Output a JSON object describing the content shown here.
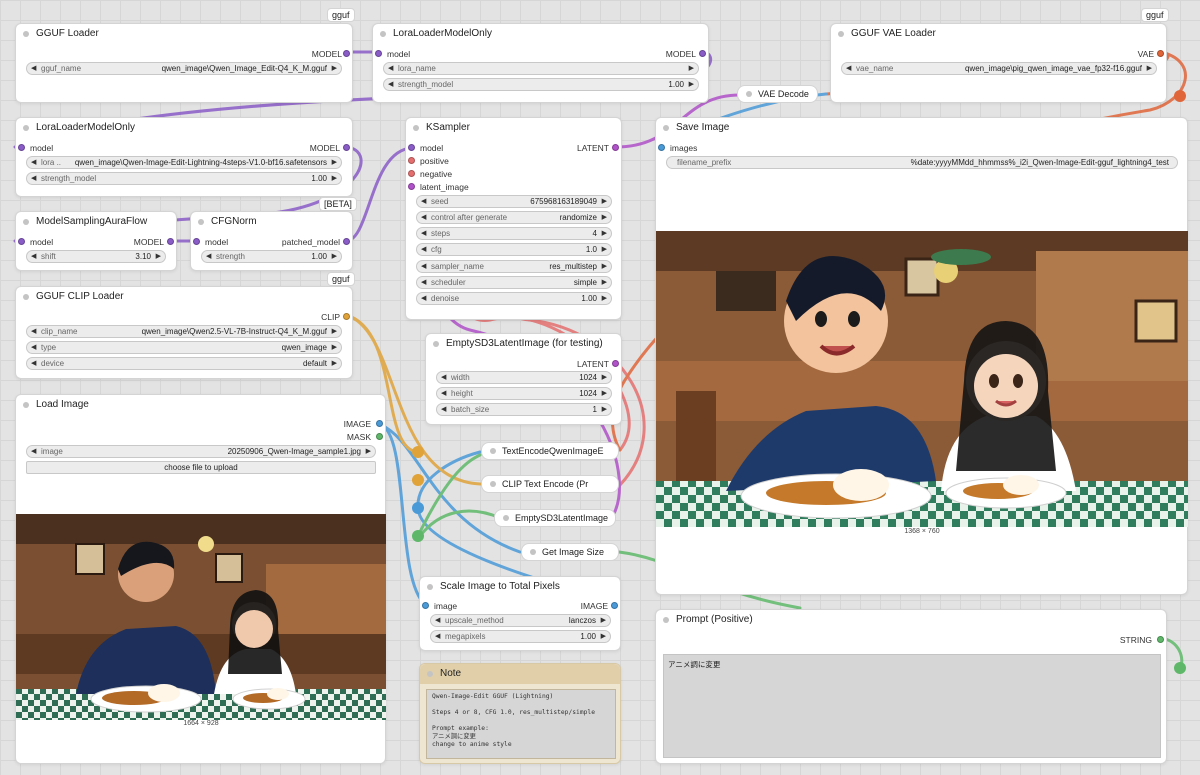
{
  "colors": {
    "model": "#8a5cc7",
    "clip": "#e0a33a",
    "image": "#4a9ad8",
    "latent": "#b052c9",
    "vae": "#e0663a",
    "conditioning": "#e56f6f",
    "mask": "#5fb86a",
    "string": "#5fb86a"
  },
  "gguf_loader": {
    "tag": "gguf",
    "title": "GGUF Loader",
    "out": "MODEL",
    "widget": {
      "name": "gguf_name",
      "value": "qwen_image\\Qwen_Image_Edit-Q4_K_M.gguf"
    }
  },
  "lora_top": {
    "title": "LoraLoaderModelOnly",
    "in": "model",
    "out": "MODEL",
    "widgets": [
      {
        "name": "lora_name",
        "value": ""
      },
      {
        "name": "strength_model",
        "value": "1.00"
      }
    ]
  },
  "vae_decode": {
    "title": "VAE Decode"
  },
  "vae_loader": {
    "tag": "gguf",
    "title": "GGUF VAE Loader",
    "out": "VAE",
    "widget": {
      "name": "vae_name",
      "value": "qwen_image\\pig_qwen_image_vae_fp32-f16.gguf"
    }
  },
  "lora_left": {
    "title": "LoraLoaderModelOnly",
    "in": "model",
    "out": "MODEL",
    "widgets": [
      {
        "name": "lora ..",
        "value": "qwen_image\\Qwen-Image-Edit-Lightning-4steps-V1.0-bf16.safetensors"
      },
      {
        "name": "strength_model",
        "value": "1.00"
      }
    ]
  },
  "msaf": {
    "title": "ModelSamplingAuraFlow",
    "in": "model",
    "out": "MODEL",
    "widget": {
      "name": "shift",
      "value": "3.10"
    }
  },
  "cfgnorm": {
    "tag": "[BETA]",
    "title": "CFGNorm",
    "in": "model",
    "out": "patched_model",
    "widget": {
      "name": "strength",
      "value": "1.00"
    }
  },
  "ksampler": {
    "title": "KSampler",
    "inputs": [
      "model",
      "positive",
      "negative",
      "latent_image"
    ],
    "out": "LATENT",
    "widgets": [
      {
        "name": "seed",
        "value": "675968163189049"
      },
      {
        "name": "control after generate",
        "value": "randomize"
      },
      {
        "name": "steps",
        "value": "4"
      },
      {
        "name": "cfg",
        "value": "1.0"
      },
      {
        "name": "sampler_name",
        "value": "res_multistep"
      },
      {
        "name": "scheduler",
        "value": "simple"
      },
      {
        "name": "denoise",
        "value": "1.00"
      }
    ]
  },
  "save_image": {
    "title": "Save Image",
    "in": "images",
    "widget": {
      "name": "filename_prefix",
      "value": "%date:yyyyMMdd_hhmmss%_i2i_Qwen-Image-Edit-gguf_lightning4_test"
    },
    "caption": "1368 × 760"
  },
  "clip_loader": {
    "tag": "gguf",
    "title": "GGUF CLIP Loader",
    "out": "CLIP",
    "widgets": [
      {
        "name": "clip_name",
        "value": "qwen_image\\Qwen2.5-VL-7B-Instruct-Q4_K_M.gguf"
      },
      {
        "name": "type",
        "value": "qwen_image"
      },
      {
        "name": "device",
        "value": "default"
      }
    ]
  },
  "empty_latent": {
    "title": "EmptySD3LatentImage (for testing)",
    "out": "LATENT",
    "widgets": [
      {
        "name": "width",
        "value": "1024"
      },
      {
        "name": "height",
        "value": "1024"
      },
      {
        "name": "batch_size",
        "value": "1"
      }
    ]
  },
  "load_image": {
    "title": "Load Image",
    "outs": [
      "IMAGE",
      "MASK"
    ],
    "widget": {
      "name": "image",
      "value": "20250906_Qwen-Image_sample1.jpg"
    },
    "button": "choose file to upload",
    "caption": "1664 × 928"
  },
  "collapsed": {
    "text_encode_qwen": "TextEncodeQwenImageE",
    "clip_text_encode": "CLIP Text Encode (Pr",
    "empty_sd3": "EmptySD3LatentImage",
    "get_image_size": "Get Image Size"
  },
  "scale_image": {
    "title": "Scale Image to Total Pixels",
    "in": "image",
    "out": "IMAGE",
    "widgets": [
      {
        "name": "upscale_method",
        "value": "lanczos"
      },
      {
        "name": "megapixels",
        "value": "1.00"
      }
    ]
  },
  "note": {
    "title": "Note",
    "text": "Qwen-Image-Edit GGUF (Lightning)\n\nSteps 4 or 8, CFG 1.0, res_multistep/simple\n\nPrompt example:\nアニメ調に変更\nchange to anime style"
  },
  "prompt": {
    "title": "Prompt (Positive)",
    "out": "STRING",
    "text": "アニメ調に変更"
  }
}
